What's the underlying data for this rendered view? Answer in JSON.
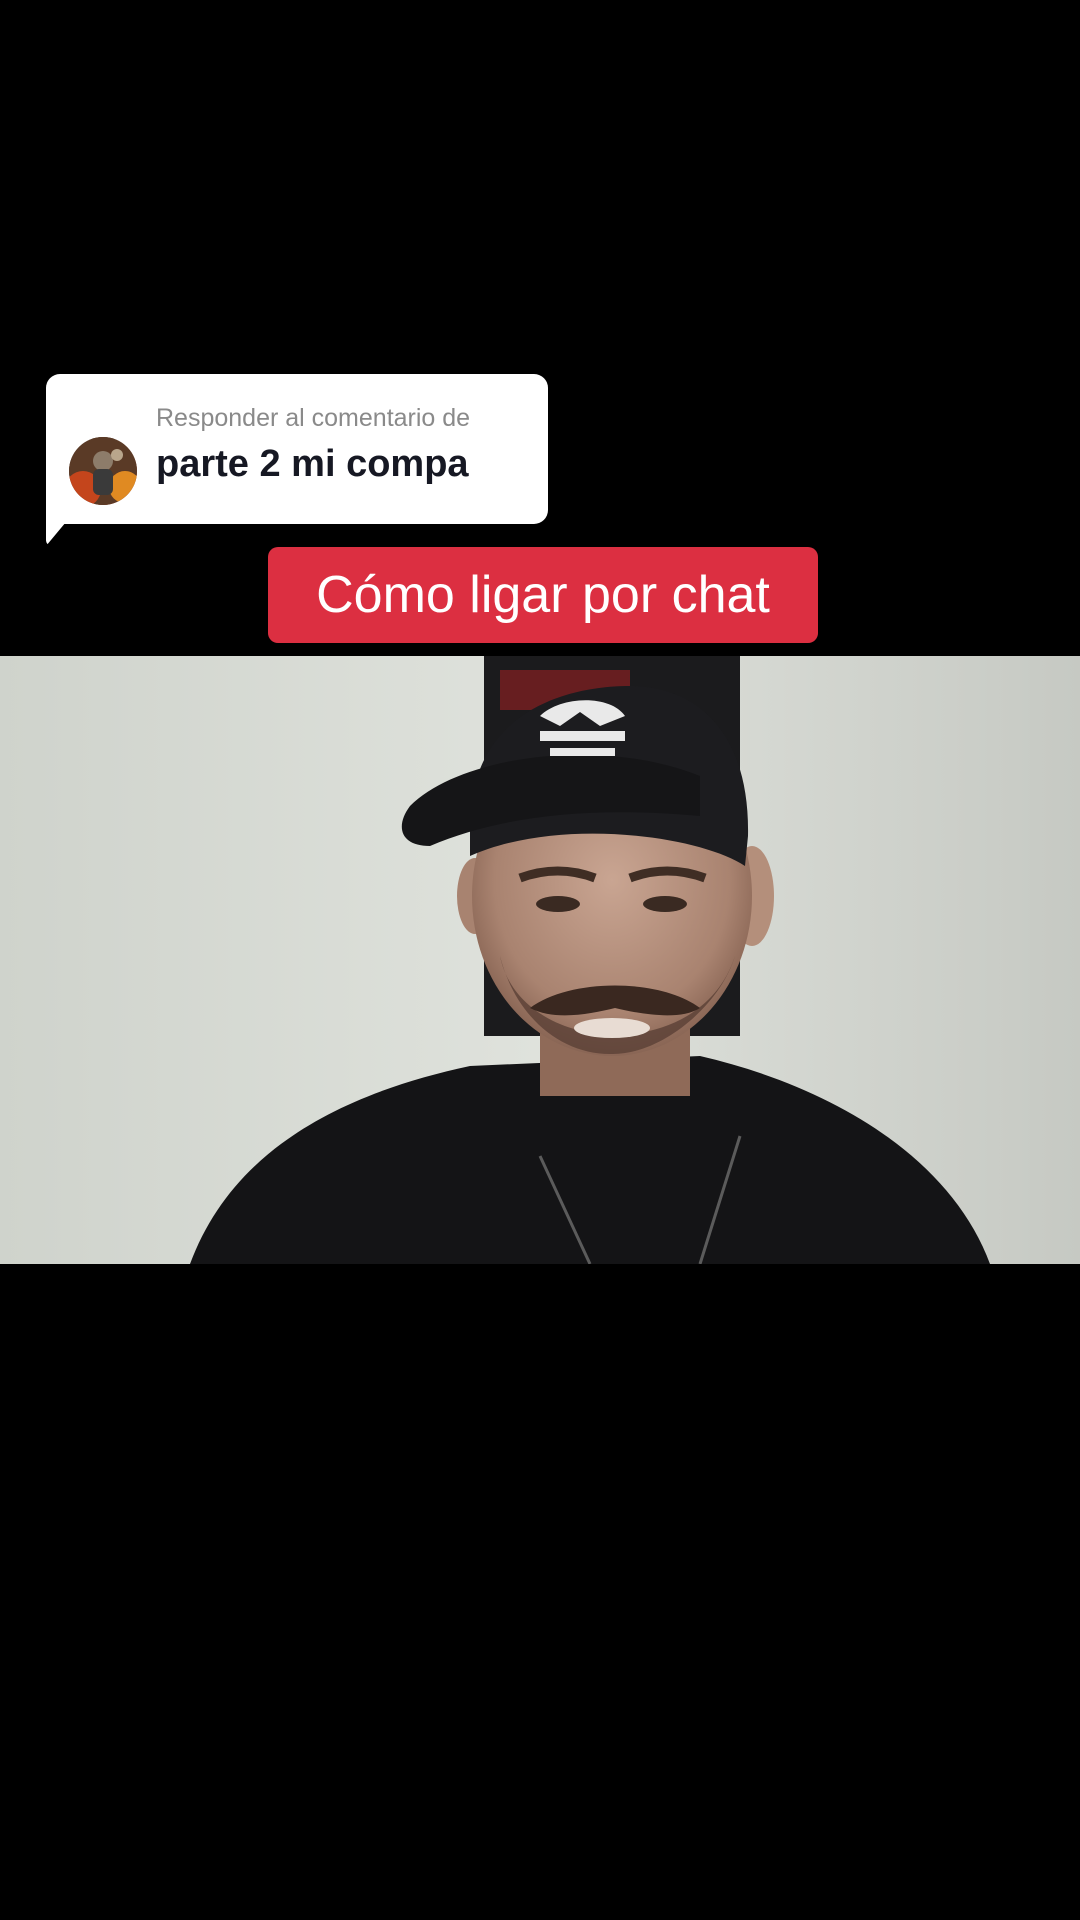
{
  "reply": {
    "heading": "Responder al comentario de",
    "comment": "parte 2 mi compa"
  },
  "title": "Cómo ligar por chat",
  "colors": {
    "background": "#000000",
    "bubble": "#ffffff",
    "title_badge": "#dc2f41",
    "heading_text": "#8a8a8a",
    "comment_text": "#161823"
  },
  "icons": {
    "avatar": "commenter-avatar",
    "video": "video-frame-person-in-cap"
  }
}
